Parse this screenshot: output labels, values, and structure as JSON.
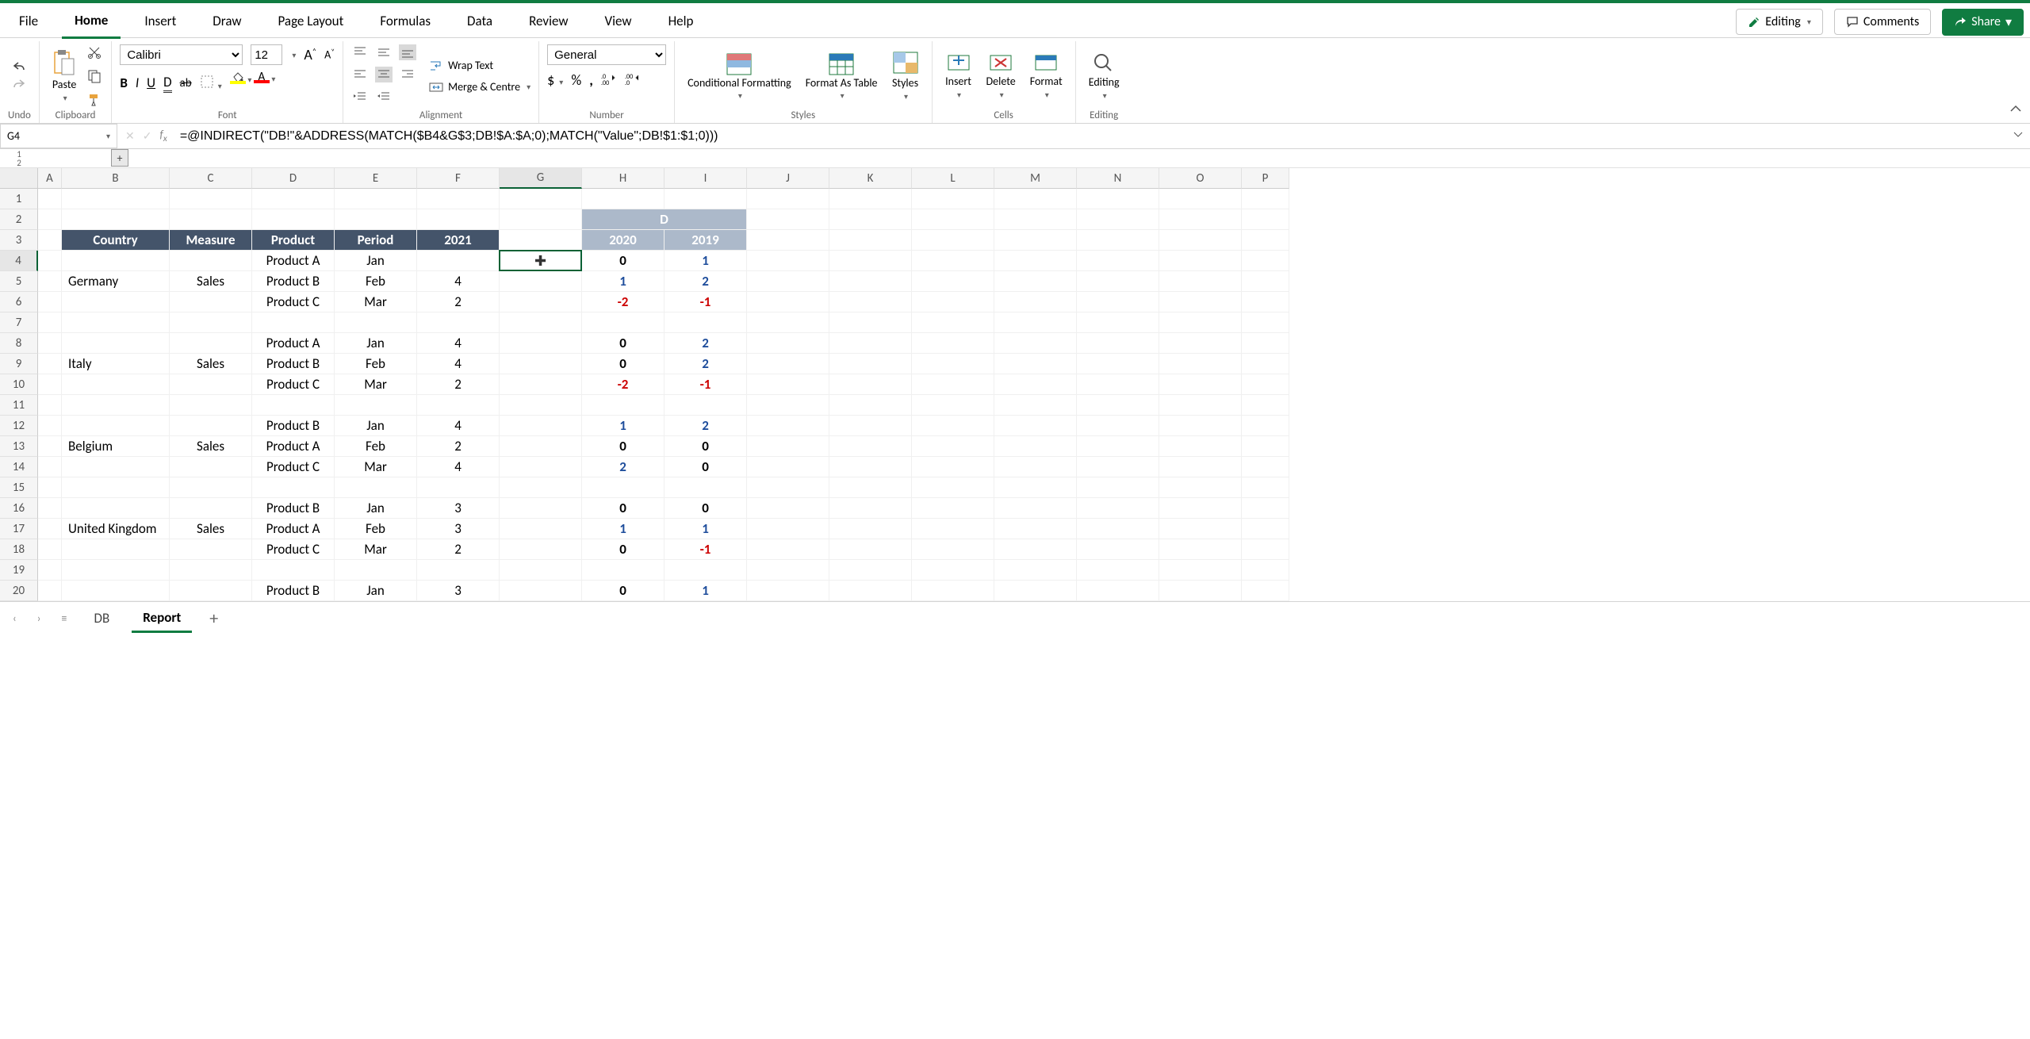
{
  "tabs": {
    "file": "File",
    "home": "Home",
    "insert": "Insert",
    "draw": "Draw",
    "pageLayout": "Page Layout",
    "formulas": "Formulas",
    "data": "Data",
    "review": "Review",
    "view": "View",
    "help": "Help"
  },
  "actions": {
    "editing": "Editing",
    "comments": "Comments",
    "share": "Share"
  },
  "groups": {
    "undo": "Undo",
    "clipboard": "Clipboard",
    "paste": "Paste",
    "font": "Font",
    "alignment": "Alignment",
    "wrap": "Wrap Text",
    "merge": "Merge & Centre",
    "number": "Number",
    "numberFormat": "General",
    "styles": "Styles",
    "condFmt": "Conditional Formatting",
    "fmtTable": "Format As Table",
    "stylesBtn": "Styles",
    "cells": "Cells",
    "insert": "Insert",
    "delete": "Delete",
    "format": "Format",
    "editingGrp": "Editing",
    "editingBtn": "Editing"
  },
  "font": {
    "name": "Calibri",
    "size": "12"
  },
  "nameBox": "G4",
  "formula": "=@INDIRECT(\"DB!\"&ADDRESS(MATCH($B4&G$3;DB!$A:$A;0);MATCH(\"Value\";DB!$1:$1;0)))",
  "outlineLevels": {
    "l1": "1",
    "l2": "2"
  },
  "columns": [
    "A",
    "B",
    "C",
    "D",
    "E",
    "F",
    "G",
    "H",
    "I",
    "J",
    "K",
    "L",
    "M",
    "N",
    "O",
    "P"
  ],
  "rowCount": 20,
  "dHeader": "D",
  "headers": {
    "country": "Country",
    "measure": "Measure",
    "product": "Product",
    "period": "Period",
    "y2021": "2021",
    "y2020": "2020",
    "y2019": "2019"
  },
  "blocks": [
    {
      "country": "Germany",
      "measure": "Sales",
      "rows": [
        {
          "product": "Product A",
          "period": "Jan",
          "y2021": "",
          "y2020": "0",
          "y2019": "1"
        },
        {
          "product": "Product B",
          "period": "Feb",
          "y2021": "4",
          "y2020": "1",
          "y2019": "2"
        },
        {
          "product": "Product C",
          "period": "Mar",
          "y2021": "2",
          "y2020": "-2",
          "y2019": "-1"
        }
      ]
    },
    {
      "country": "Italy",
      "measure": "Sales",
      "rows": [
        {
          "product": "Product A",
          "period": "Jan",
          "y2021": "4",
          "y2020": "0",
          "y2019": "2"
        },
        {
          "product": "Product B",
          "period": "Feb",
          "y2021": "4",
          "y2020": "0",
          "y2019": "2"
        },
        {
          "product": "Product C",
          "period": "Mar",
          "y2021": "2",
          "y2020": "-2",
          "y2019": "-1"
        }
      ]
    },
    {
      "country": "Belgium",
      "measure": "Sales",
      "rows": [
        {
          "product": "Product B",
          "period": "Jan",
          "y2021": "4",
          "y2020": "1",
          "y2019": "2"
        },
        {
          "product": "Product A",
          "period": "Feb",
          "y2021": "2",
          "y2020": "0",
          "y2019": "0"
        },
        {
          "product": "Product C",
          "period": "Mar",
          "y2021": "4",
          "y2020": "2",
          "y2019": "0"
        }
      ]
    },
    {
      "country": "United Kingdom",
      "measure": "Sales",
      "rows": [
        {
          "product": "Product B",
          "period": "Jan",
          "y2021": "3",
          "y2020": "0",
          "y2019": "0"
        },
        {
          "product": "Product A",
          "period": "Feb",
          "y2021": "3",
          "y2020": "1",
          "y2019": "1"
        },
        {
          "product": "Product C",
          "period": "Mar",
          "y2021": "2",
          "y2020": "0",
          "y2019": "-1"
        }
      ]
    },
    {
      "country": "",
      "measure": "",
      "rows": [
        {
          "product": "Product B",
          "period": "Jan",
          "y2021": "3",
          "y2020": "0",
          "y2019": "1"
        }
      ]
    }
  ],
  "sheets": {
    "db": "DB",
    "report": "Report"
  }
}
